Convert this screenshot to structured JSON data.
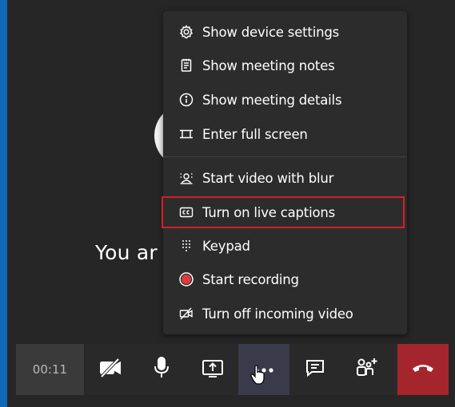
{
  "stage": {
    "caption": "You ar"
  },
  "menu": {
    "items": [
      {
        "label": "Show device settings",
        "icon": "gear-icon"
      },
      {
        "label": "Show meeting notes",
        "icon": "notes-icon"
      },
      {
        "label": "Show meeting details",
        "icon": "info-icon"
      },
      {
        "label": "Enter full screen",
        "icon": "fullscreen-icon"
      },
      {
        "label": "Start video with blur",
        "icon": "blur-icon"
      },
      {
        "label": "Turn on live captions",
        "icon": "captions-icon"
      },
      {
        "label": "Keypad",
        "icon": "keypad-icon"
      },
      {
        "label": "Start recording",
        "icon": "record-icon"
      },
      {
        "label": "Turn off incoming video",
        "icon": "video-off-icon"
      }
    ],
    "highlighted_item": "Turn on live captions"
  },
  "callbar": {
    "timer": "00:11",
    "controls": [
      "camera-off-icon",
      "microphone-icon",
      "share-screen-icon",
      "more-options-icon",
      "chat-icon",
      "participants-icon",
      "hang-up-icon"
    ]
  },
  "colors": {
    "background": "#262626",
    "menu": "#2d2c2c",
    "highlight_border": "#d51f26",
    "hangup": "#a4262c",
    "record_dot": "#e03a3e"
  }
}
